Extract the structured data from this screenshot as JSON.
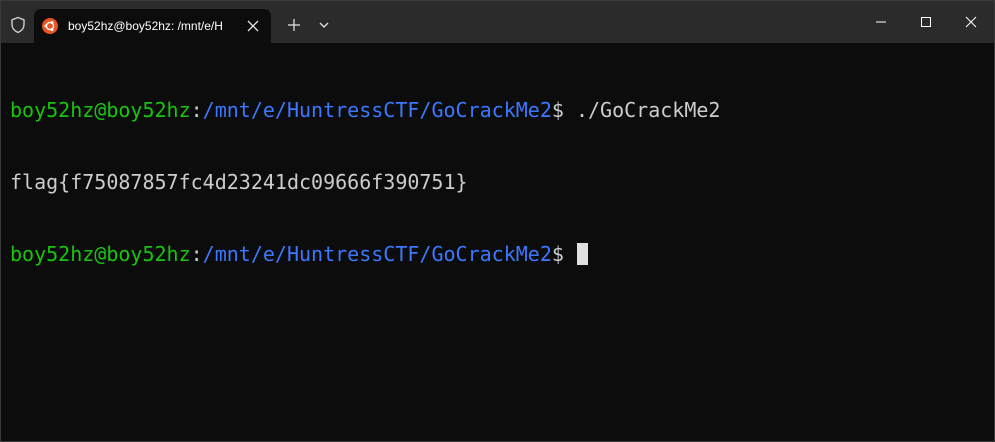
{
  "window": {
    "tab_title": "boy52hz@boy52hz: /mnt/e/H",
    "controls": {
      "minimize_icon": "minimize-icon",
      "maximize_icon": "maximize-icon",
      "close_icon": "close-icon"
    }
  },
  "terminal": {
    "colors": {
      "background": "#0c0c0c",
      "user": "#16c60c",
      "path": "#3b78ff",
      "text": "#cccccc",
      "cursor": "#e0e0e0"
    },
    "lines": [
      {
        "user": "boy52hz@boy52hz",
        "sep": ":",
        "path": "/mnt/e/HuntressCTF/GoCrackMe2",
        "prompt": "$ ",
        "command": "./GoCrackMe2"
      },
      {
        "output": "flag{f75087857fc4d23241dc09666f390751}"
      },
      {
        "user": "boy52hz@boy52hz",
        "sep": ":",
        "path": "/mnt/e/HuntressCTF/GoCrackMe2",
        "prompt": "$ "
      }
    ]
  }
}
